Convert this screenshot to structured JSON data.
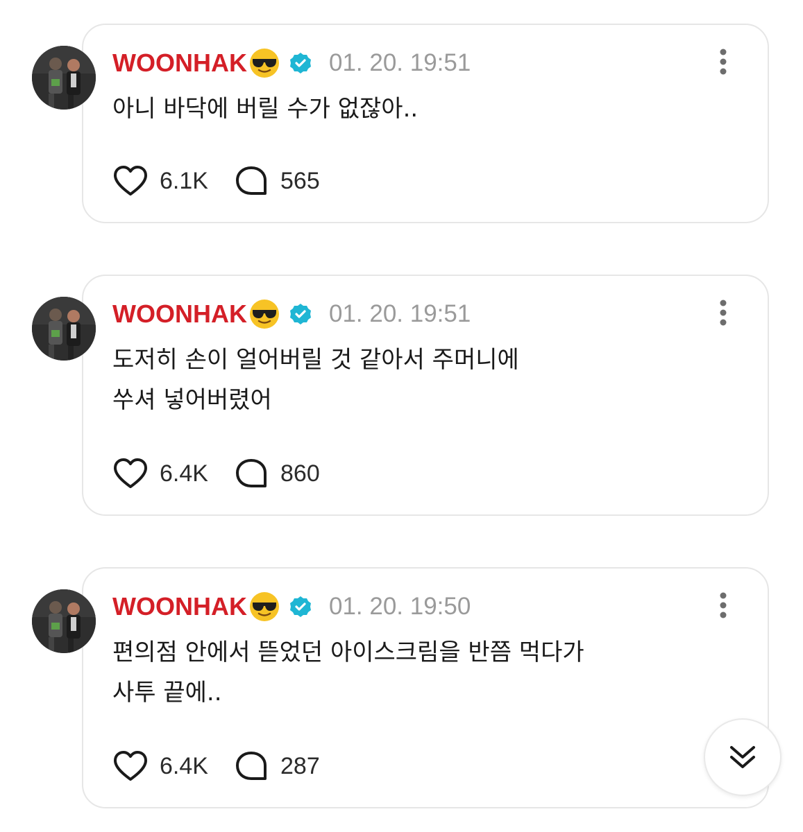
{
  "posts": [
    {
      "author": "WOONHAK",
      "timestamp": "01. 20. 19:51",
      "text": "아니 바닥에 버릴 수가 없잖아..",
      "likes": "6.1K",
      "comments": "565"
    },
    {
      "author": "WOONHAK",
      "timestamp": "01. 20. 19:51",
      "text": "도저히 손이 얼어버릴 것 같아서 주머니에\n쑤셔 넣어버렸어",
      "likes": "6.4K",
      "comments": "860"
    },
    {
      "author": "WOONHAK",
      "timestamp": "01. 20. 19:50",
      "text": "편의점 안에서 뜯었던 아이스크림을 반쯤 먹다가\n사투 끝에..",
      "likes": "6.4K",
      "comments": "287"
    }
  ],
  "icons": {
    "author_emoji": "sunglasses-face-emoji",
    "verified": "verified-badge-icon",
    "more": "more-vertical-icon",
    "like": "heart-icon",
    "comment": "comment-bubble-icon",
    "scroll": "double-chevron-down-icon"
  },
  "colors": {
    "author_name": "#d41f27",
    "verified": "#1fb6d4",
    "timestamp": "#9a9a9a",
    "card_border": "#e6e6e6"
  }
}
